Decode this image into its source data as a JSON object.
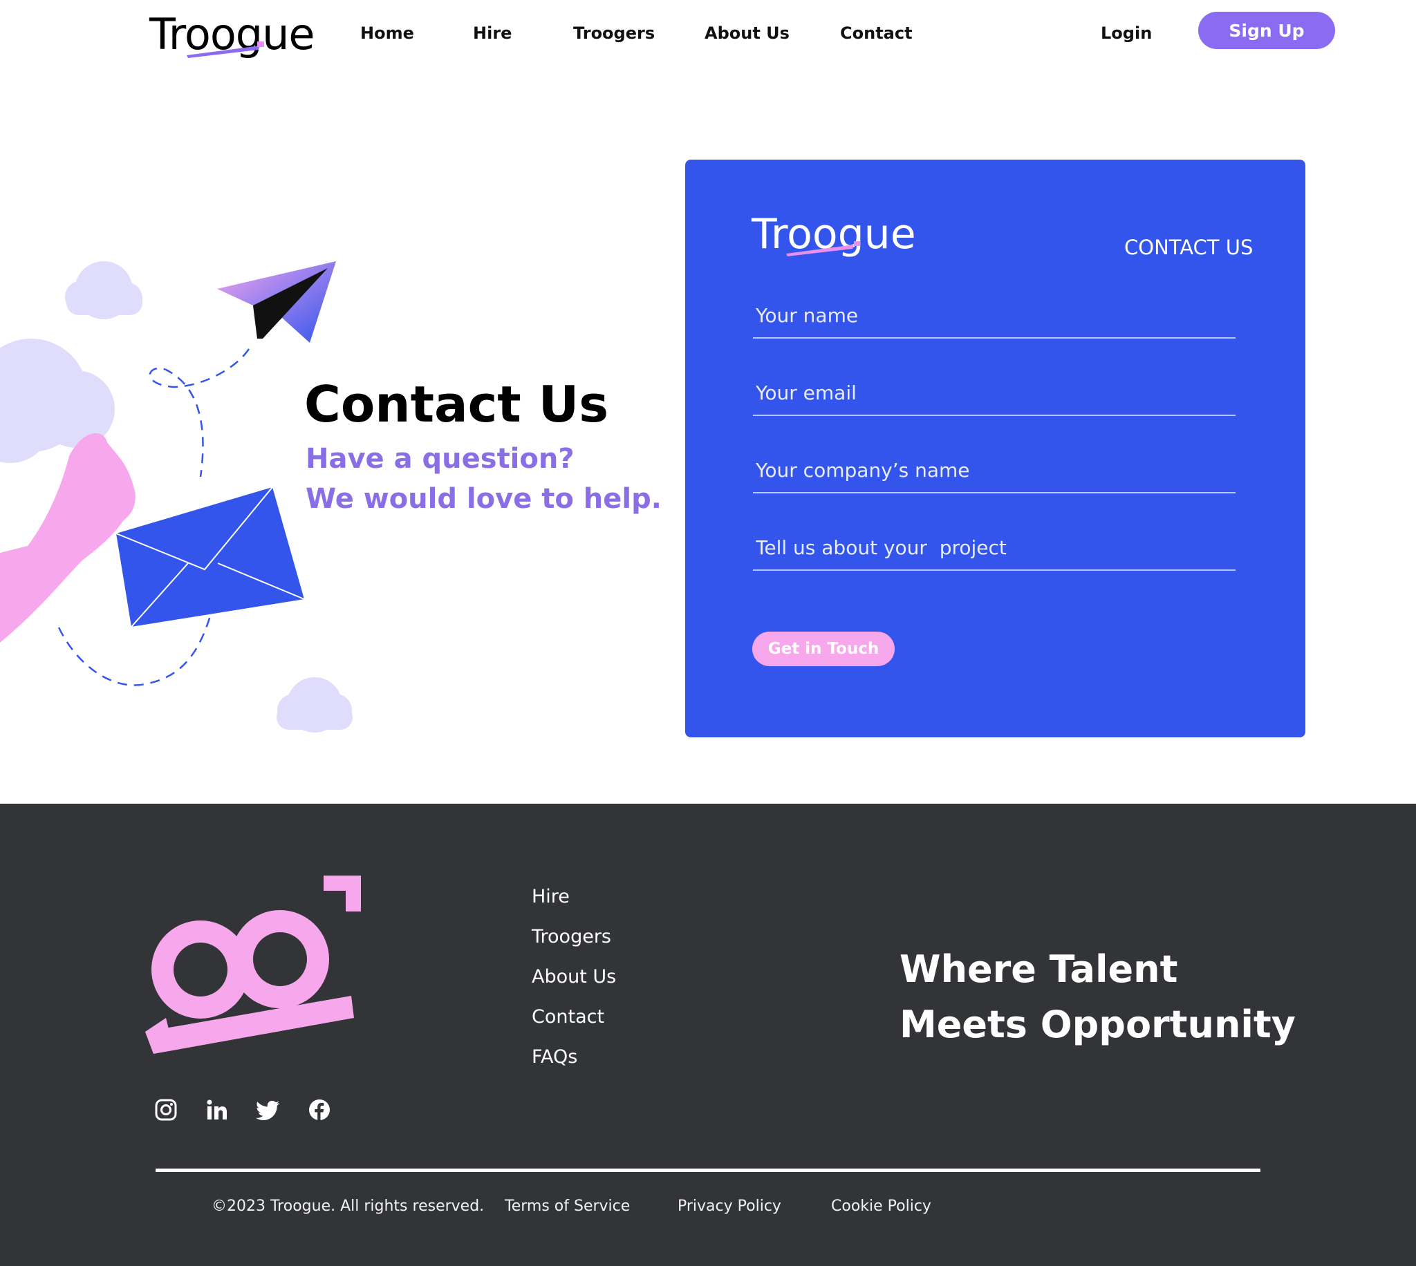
{
  "brand": {
    "name": "Troogue",
    "colors": {
      "primary_blue": "#3355ec",
      "accent_purple": "#8b6bf2",
      "accent_pink": "#f7a8ec",
      "footer_bg": "#323437"
    }
  },
  "header": {
    "nav": [
      {
        "label": "Home"
      },
      {
        "label": "Hire"
      },
      {
        "label": "Troogers"
      },
      {
        "label": "About Us"
      },
      {
        "label": "Contact"
      }
    ],
    "login_label": "Login",
    "signup_label": "Sign Up"
  },
  "hero": {
    "title": "Contact Us",
    "subtitle_line1": "Have a question?",
    "subtitle_line2": "We would love to help."
  },
  "contact_card": {
    "logo_text": "Troogue",
    "heading": "CONTACT US",
    "fields": [
      {
        "placeholder": "Your name",
        "value": ""
      },
      {
        "placeholder": "Your email",
        "value": ""
      },
      {
        "placeholder": "Your company’s name",
        "value": ""
      },
      {
        "placeholder": "Tell us about your  project",
        "value": ""
      }
    ],
    "submit_label": "Get in Touch"
  },
  "footer": {
    "links": [
      {
        "label": "Hire"
      },
      {
        "label": "Troogers"
      },
      {
        "label": "About Us"
      },
      {
        "label": "Contact"
      },
      {
        "label": "FAQs"
      }
    ],
    "tagline_line1": "Where Talent",
    "tagline_line2": "Meets Opportunity",
    "social_icons": [
      "instagram-icon",
      "linkedin-icon",
      "twitter-icon",
      "facebook-icon"
    ],
    "copyright": "©2023 Troogue. All rights reserved.",
    "legal_links": [
      {
        "label": "Terms of Service"
      },
      {
        "label": "Privacy Policy"
      },
      {
        "label": "Cookie Policy"
      }
    ]
  }
}
